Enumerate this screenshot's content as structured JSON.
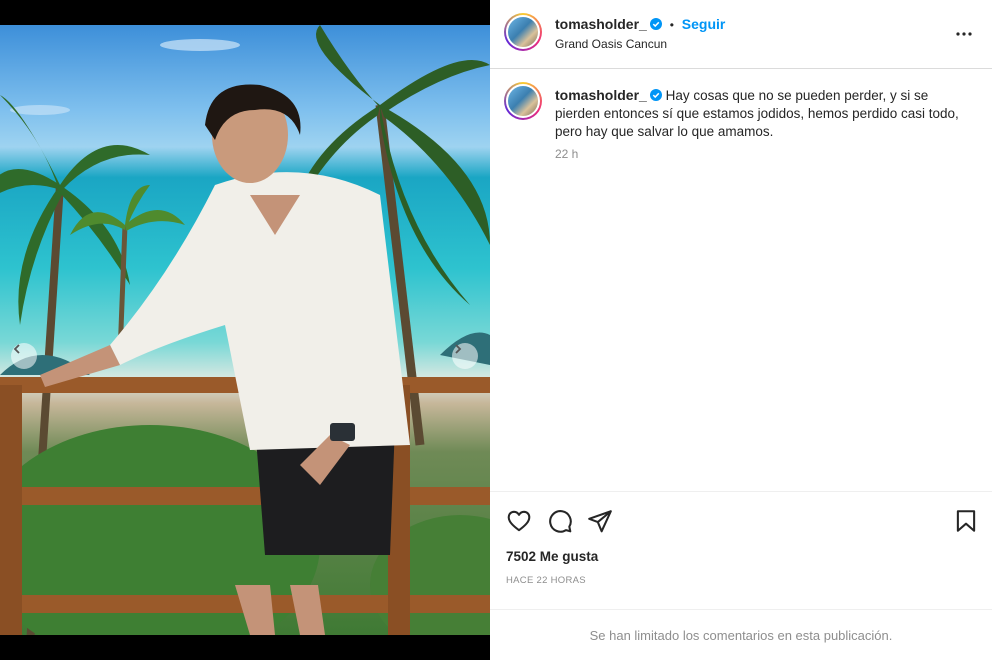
{
  "post": {
    "username": "tomasholder_",
    "follow_label": "Seguir",
    "separator": "•",
    "location": "Grand Oasis Cancun",
    "caption": "Hay cosas que no se pueden perder, y si se pierden entonces sí que estamos jodidos, hemos perdido casi todo, pero hay que salvar lo que amamos.",
    "caption_time": "22 h",
    "likes": "7502 Me gusta",
    "posted_ago": "HACE 22 HORAS",
    "comments_limited": "Se han limitado los comentarios en esta publicación."
  },
  "carousel": {
    "total": 6,
    "active": 2
  },
  "icons": {
    "verified": "verified-badge-icon",
    "more": "more-options-icon",
    "like": "heart-icon",
    "comment": "comment-icon",
    "share": "share-icon",
    "save": "bookmark-icon",
    "prev": "chevron-left-icon",
    "next": "chevron-right-icon"
  },
  "colors": {
    "accent": "#0095f6",
    "verified": "#0095f6",
    "text": "#262626",
    "muted": "#8e8e8e"
  }
}
